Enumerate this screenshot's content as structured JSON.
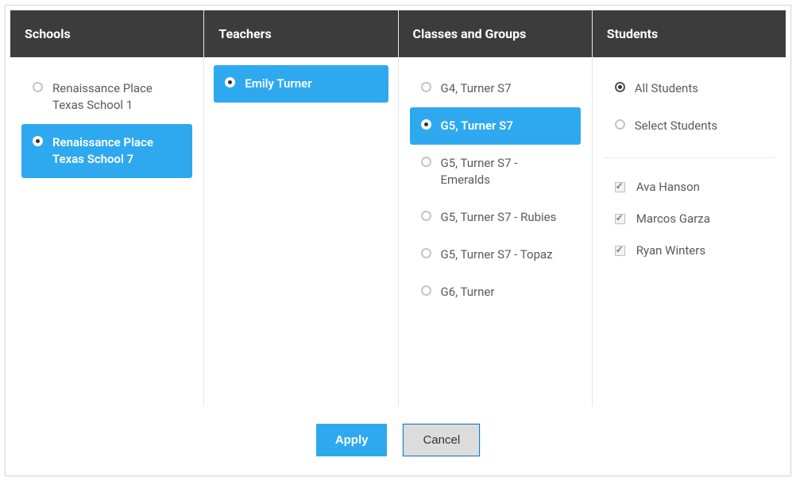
{
  "columns": {
    "schools": {
      "header": "Schools",
      "items": [
        {
          "label": "Renaissance Place Texas School 1",
          "selected": false
        },
        {
          "label": "Renaissance Place Texas School 7",
          "selected": true
        }
      ]
    },
    "teachers": {
      "header": "Teachers",
      "items": [
        {
          "label": "Emily Turner",
          "selected": true
        }
      ]
    },
    "classes": {
      "header": "Classes and Groups",
      "items": [
        {
          "label": "G4, Turner S7",
          "selected": false
        },
        {
          "label": "G5, Turner S7",
          "selected": true
        },
        {
          "label": "G5, Turner S7 - Emeralds",
          "selected": false
        },
        {
          "label": "G5, Turner S7 - Rubies",
          "selected": false
        },
        {
          "label": "G5, Turner S7 - Topaz",
          "selected": false
        },
        {
          "label": "G6, Turner",
          "selected": false
        }
      ]
    },
    "students": {
      "header": "Students",
      "options": [
        {
          "label": "All Students",
          "checked": true
        },
        {
          "label": "Select Students",
          "checked": false
        }
      ],
      "list": [
        {
          "label": "Ava Hanson",
          "checked": true
        },
        {
          "label": "Marcos Garza",
          "checked": true
        },
        {
          "label": "Ryan Winters",
          "checked": true
        }
      ]
    }
  },
  "buttons": {
    "apply": "Apply",
    "cancel": "Cancel"
  }
}
